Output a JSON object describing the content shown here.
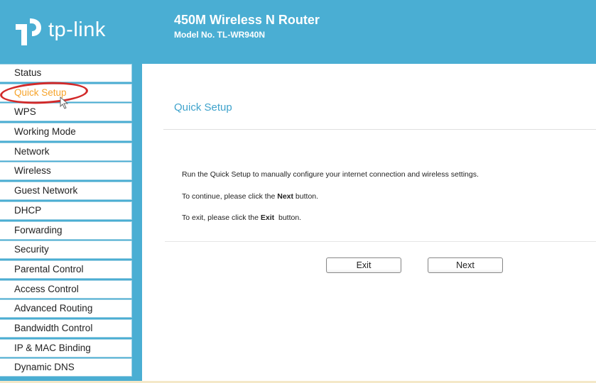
{
  "header": {
    "brand": "tp-link",
    "router_title": "450M Wireless N Router",
    "model_no": "Model No. TL-WR940N"
  },
  "sidebar": {
    "items": [
      {
        "label": "Status"
      },
      {
        "label": "Quick Setup",
        "active": true
      },
      {
        "label": "WPS"
      },
      {
        "label": "Working Mode"
      },
      {
        "label": "Network"
      },
      {
        "label": "Wireless"
      },
      {
        "label": "Guest Network"
      },
      {
        "label": "DHCP"
      },
      {
        "label": "Forwarding"
      },
      {
        "label": "Security"
      },
      {
        "label": "Parental Control"
      },
      {
        "label": "Access Control"
      },
      {
        "label": "Advanced Routing"
      },
      {
        "label": "Bandwidth Control"
      },
      {
        "label": "IP & MAC Binding"
      },
      {
        "label": "Dynamic DNS"
      }
    ]
  },
  "main": {
    "title": "Quick Setup",
    "message_1": "Run the Quick Setup to manually configure your internet connection and wireless settings.",
    "message_2_prefix": "To continue, please click the ",
    "message_2_bold": "Next",
    "message_2_suffix": " button.",
    "message_3_prefix": "To exit, please click the ",
    "message_3_bold": "Exit",
    "message_3_suffix": "  button.",
    "exit_label": "Exit",
    "next_label": "Next"
  },
  "colors": {
    "brand_blue": "#4aaed3",
    "title_blue": "#3fa3cc",
    "active_orange": "#f6a32a",
    "highlight_red": "#d22a2a"
  }
}
